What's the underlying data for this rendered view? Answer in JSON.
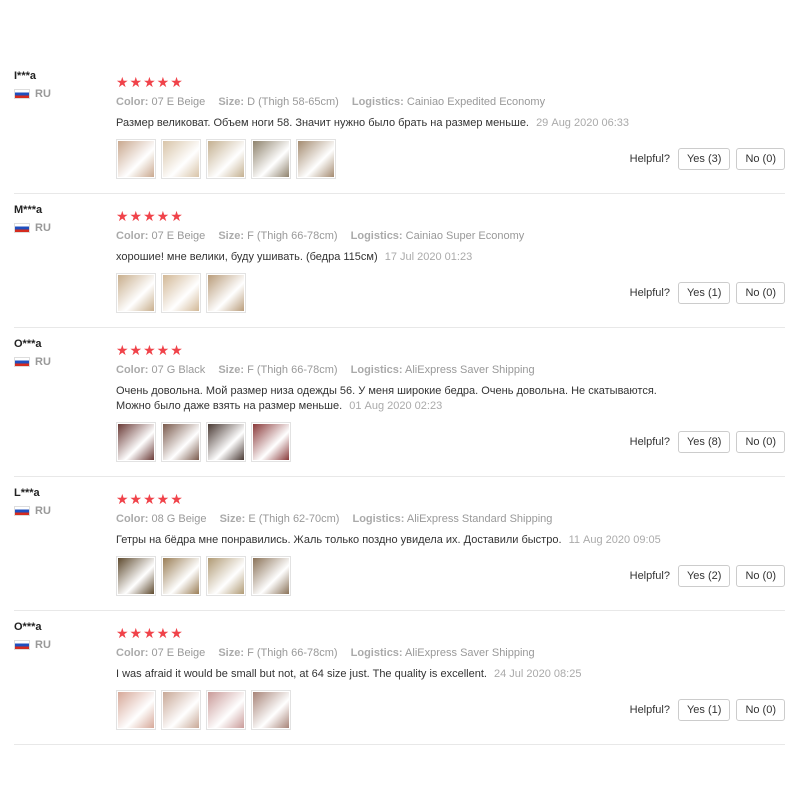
{
  "helpful_label": "Helpful?",
  "labels": {
    "color": "Color:",
    "size": "Size:",
    "logistics": "Logistics:"
  },
  "accent": "#f0434a",
  "reviews": [
    {
      "user": "I***a",
      "country": "RU",
      "rating": 5,
      "stars": "★★★★★",
      "color": "07 E Beige",
      "size": "D (Thigh 58-65cm)",
      "logistics": "Cainiao Expedited Economy",
      "text": "Размер великоват. Объем ноги 58. Значит нужно было брать на размер меньше.",
      "date": "29 Aug 2020 06:33",
      "yes": "Yes (3)",
      "no": "No (0)",
      "thumbs": [
        "#c9a88e",
        "#d8c4a8",
        "#c4b090",
        "#8e826c",
        "#a48b70"
      ]
    },
    {
      "user": "M***a",
      "country": "RU",
      "rating": 5,
      "stars": "★★★★★",
      "color": "07 E Beige",
      "size": "F (Thigh 66-78cm)",
      "logistics": "Cainiao Super Economy",
      "text": "хорошие! мне велики, буду ушивать. (бедра 115см)",
      "date": "17 Jul 2020 01:23",
      "yes": "Yes (1)",
      "no": "No (0)",
      "thumbs": [
        "#c8ae8c",
        "#d2b896",
        "#b99c7a"
      ]
    },
    {
      "user": "O***a",
      "country": "RU",
      "rating": 5,
      "stars": "★★★★★",
      "color": "07 G Black",
      "size": "F (Thigh 66-78cm)",
      "logistics": "AliExpress Saver Shipping",
      "text": "Очень довольна. Мой размер низа одежды 56. У меня широкие бедра. Очень довольна. Не скатываются. Можно было даже взять на размер меньше.",
      "date": "01 Aug 2020 02:23",
      "yes": "Yes (8)",
      "no": "No (0)",
      "thumbs": [
        "#6a3a36",
        "#7a5a4c",
        "#4a3a34",
        "#8a3a3a"
      ]
    },
    {
      "user": "L***a",
      "country": "RU",
      "rating": 5,
      "stars": "★★★★★",
      "color": "08 G Beige",
      "size": "E (Thigh 62-70cm)",
      "logistics": "AliExpress Standard Shipping",
      "text": "Гетры на бёдра мне понравились. Жаль только поздно увидела их. Доставили быстро.",
      "date": "11 Aug 2020 09:05",
      "yes": "Yes (2)",
      "no": "No (0)",
      "thumbs": [
        "#5e4a2e",
        "#9a7e56",
        "#b09a74",
        "#8a7258"
      ]
    },
    {
      "user": "O***a",
      "country": "RU",
      "rating": 5,
      "stars": "★★★★★",
      "color": "07 E Beige",
      "size": "F (Thigh 66-78cm)",
      "logistics": "AliExpress Saver Shipping",
      "text": "I was afraid it would be small but not, at 64 size just. The quality is excellent.",
      "date": "24 Jul 2020 08:25",
      "yes": "Yes (1)",
      "no": "No (0)",
      "thumbs": [
        "#d6a898",
        "#c8a896",
        "#c99a98",
        "#a88478"
      ]
    }
  ]
}
